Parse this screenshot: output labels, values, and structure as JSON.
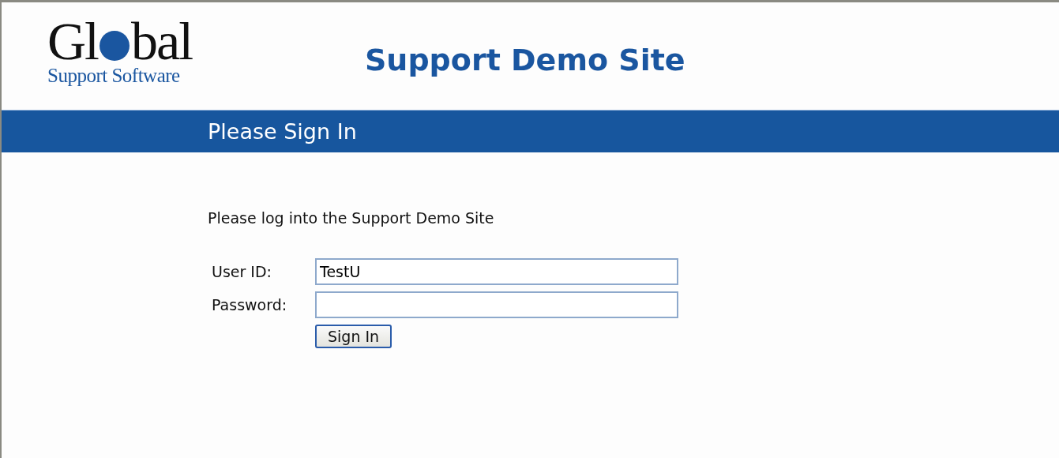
{
  "logo": {
    "text_before": "Gl",
    "text_after": "bal",
    "tagline": "Support Software"
  },
  "site_title": "Support Demo Site",
  "section_bar": {
    "title": "Please Sign In"
  },
  "intro": "Please log into the Support Demo Site",
  "fields": [
    {
      "label": "User ID:",
      "value": "TestU",
      "kind": "text"
    },
    {
      "label": "Password:",
      "kind": "password"
    }
  ],
  "buttons": [
    "Sign In"
  ]
}
